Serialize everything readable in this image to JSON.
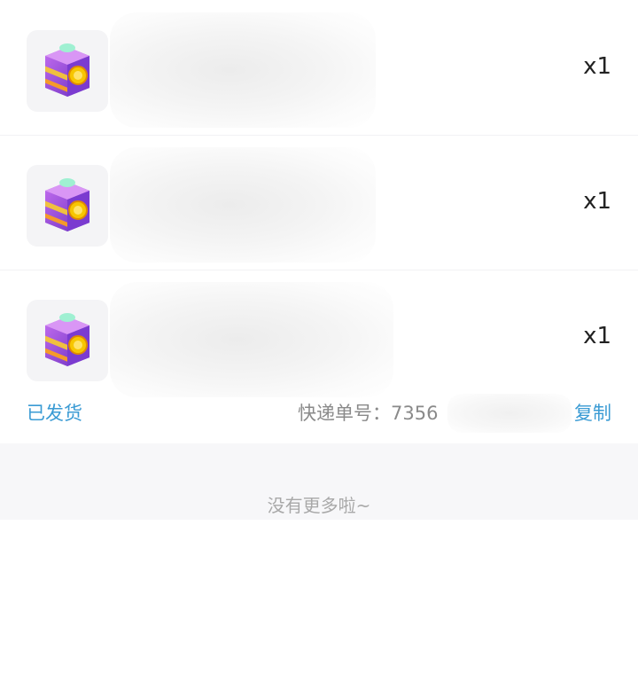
{
  "order": {
    "items": [
      {
        "icon": "treasure-box-icon",
        "quantity": "x1"
      },
      {
        "icon": "treasure-box-icon",
        "quantity": "x1"
      },
      {
        "icon": "treasure-box-icon",
        "quantity": "x1"
      }
    ],
    "status": "已发货",
    "tracking_label": "快递单号：7356",
    "copy_label": "复制"
  },
  "footer": {
    "no_more": "没有更多啦~"
  },
  "colors": {
    "accent": "#3a9bd4",
    "box_purple": "#8a4fd8",
    "box_gold": "#f2b705",
    "box_mint": "#7fe0c0"
  }
}
